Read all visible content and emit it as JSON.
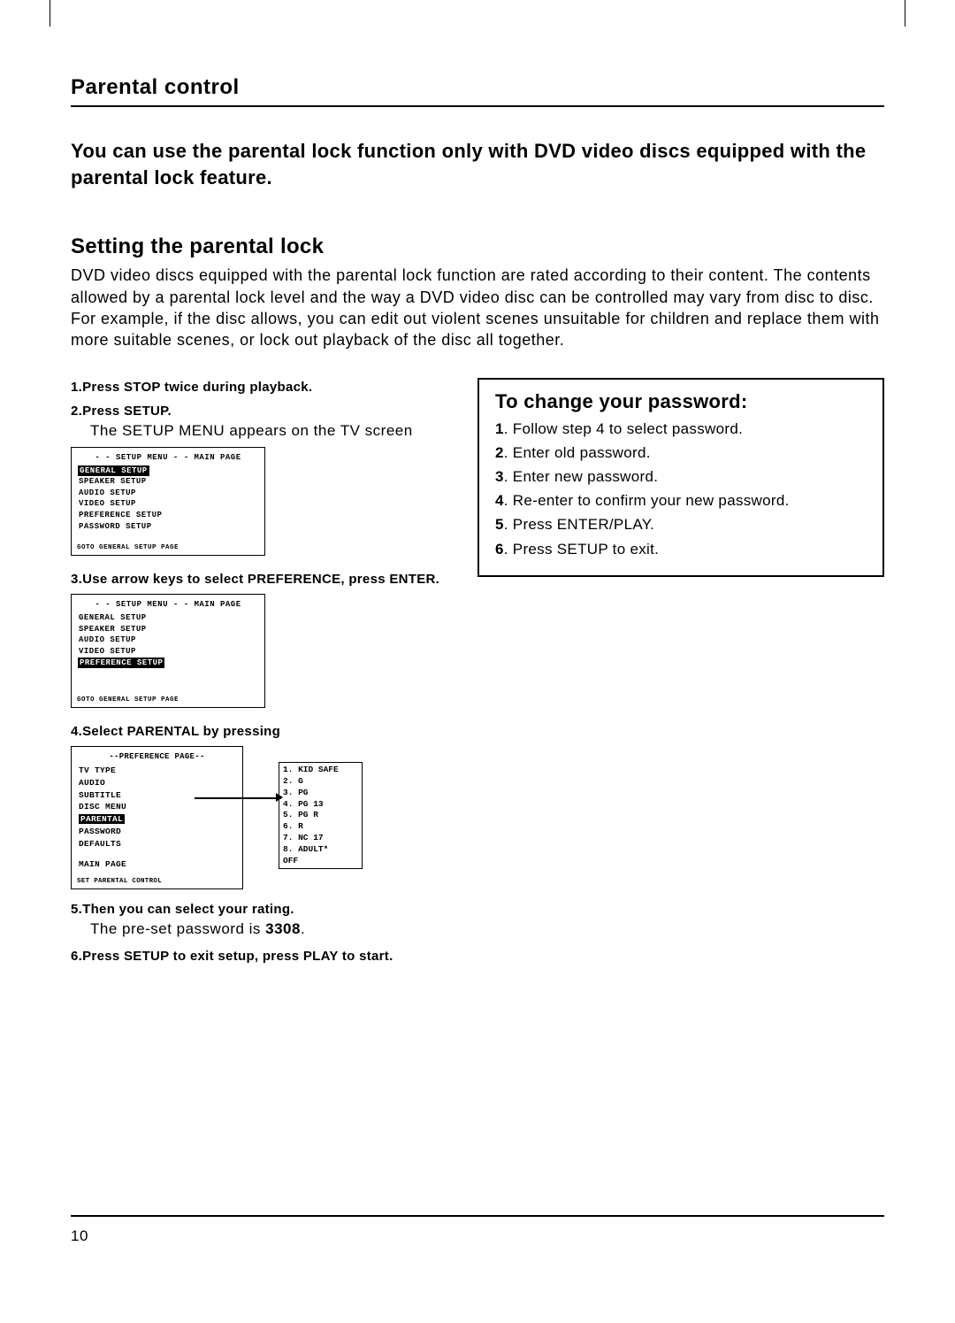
{
  "section_title": "Parental control",
  "intro": "You can use the parental lock function only with DVD video discs equipped with the parental lock feature.",
  "subhead": "Setting the parental lock",
  "body": "DVD video discs equipped with the parental lock function are rated according to their content. The contents allowed by a parental lock level and the way a DVD video disc can be controlled may vary from disc to disc. For example, if the disc allows, you can edit out violent scenes unsuitable for children and replace them with more suitable scenes, or lock out playback of the disc all together.",
  "steps": {
    "s1_num": "1",
    "s1_label": ".Press STOP twice during playback.",
    "s2_num": "2",
    "s2_label": ".Press SETUP.",
    "s2_detail": "The SETUP MENU appears on the TV screen",
    "s3_num": "3",
    "s3_label": ".Use arrow keys to select PREFERENCE, press ENTER.",
    "s4_num": "4",
    "s4_label": ".Select PARENTAL by pressing",
    "s5_num": "5",
    "s5_label": ".Then you can select your rating.",
    "s5_detail_pre": "The pre-set password is ",
    "s5_pw": "3308",
    "s5_detail_post": ".",
    "s6_num": "6",
    "s6_label": ".Press SETUP to exit setup, press PLAY to start."
  },
  "menu1": {
    "title": "- - SETUP MENU - - MAIN PAGE",
    "items": [
      "GENERAL SETUP",
      "SPEAKER SETUP",
      "AUDIO SETUP",
      "VIDEO SETUP",
      "PREFERENCE SETUP",
      "PASSWORD SETUP"
    ],
    "highlight": "GENERAL SETUP",
    "footer": "GOTO GENERAL SETUP PAGE"
  },
  "menu2": {
    "title": "- - SETUP MENU - - MAIN PAGE",
    "items": [
      "GENERAL SETUP",
      "SPEAKER SETUP",
      "AUDIO SETUP",
      "VIDEO SETUP",
      "PREFERENCE SETUP"
    ],
    "highlight": "PREFERENCE SETUP",
    "footer": "GOTO GENERAL SETUP PAGE"
  },
  "pref_menu": {
    "title": "--PREFERENCE PAGE--",
    "items": [
      "TV TYPE",
      "AUDIO",
      "SUBTITLE",
      "DISC MENU",
      "PARENTAL",
      "PASSWORD",
      "DEFAULTS",
      "",
      "MAIN PAGE"
    ],
    "highlight": "PARENTAL",
    "footer": "SET PARENTAL CONTROL"
  },
  "ratings": [
    "1. KID SAFE",
    "2. G",
    "3. PG",
    "4. PG 13",
    "5. PG R",
    "6. R",
    "7. NC 17",
    "8. ADULT*",
    "OFF"
  ],
  "pw_box": {
    "title": "To change your password:",
    "steps": [
      {
        "n": "1",
        "t": ". Follow step 4 to select password."
      },
      {
        "n": "2",
        "t": ". Enter old password."
      },
      {
        "n": "3",
        "t": ". Enter new password."
      },
      {
        "n": "4",
        "t": ". Re-enter to confirm your new password."
      },
      {
        "n": "5",
        "t": ". Press ENTER/PLAY."
      },
      {
        "n": "6",
        "t": ". Press SETUP to exit."
      }
    ]
  },
  "page_number": "10"
}
